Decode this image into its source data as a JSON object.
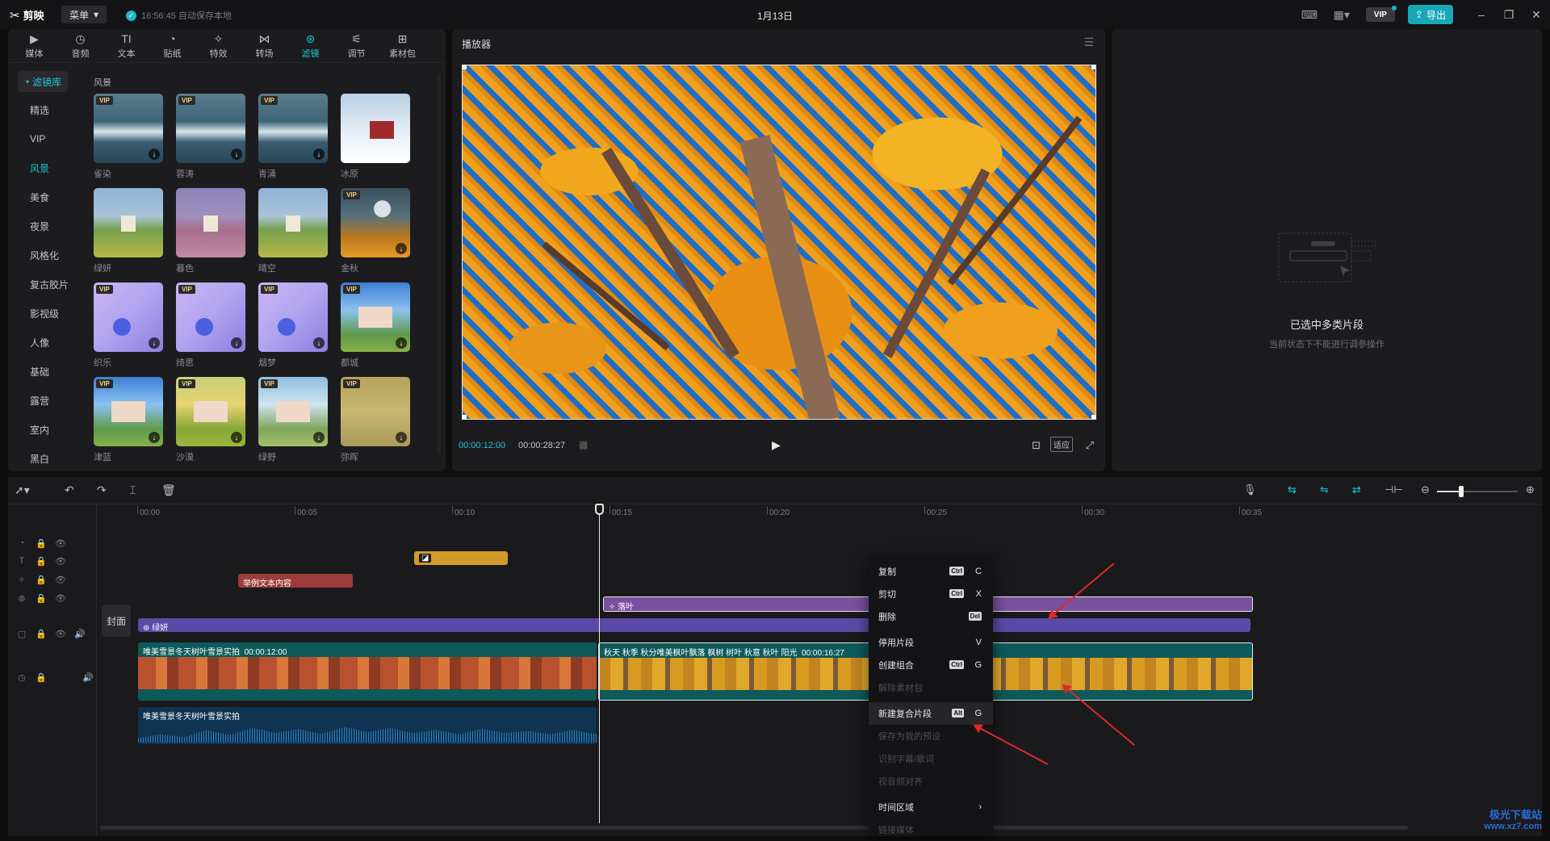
{
  "app": {
    "name": "剪映",
    "menu_label": "菜单",
    "autosave": "16:56:45 自动保存本地",
    "project_title": "1月13日"
  },
  "titlebar": {
    "vip_label": "VIP",
    "export_label": "导出"
  },
  "categories": [
    {
      "label": "媒体",
      "icon": "media-icon"
    },
    {
      "label": "音频",
      "icon": "audio-icon"
    },
    {
      "label": "文本",
      "icon": "text-icon"
    },
    {
      "label": "贴纸",
      "icon": "sticker-icon"
    },
    {
      "label": "特效",
      "icon": "effect-icon"
    },
    {
      "label": "转场",
      "icon": "transition-icon"
    },
    {
      "label": "滤镜",
      "icon": "filter-icon"
    },
    {
      "label": "调节",
      "icon": "adjust-icon"
    },
    {
      "label": "素材包",
      "icon": "package-icon"
    }
  ],
  "active_category": "滤镜",
  "sidebar": {
    "header": "滤镜库",
    "items": [
      "精选",
      "VIP",
      "风景",
      "美食",
      "夜景",
      "风格化",
      "复古胶片",
      "影视级",
      "人像",
      "基础",
      "露营",
      "室内",
      "黑白"
    ],
    "active": "风景"
  },
  "filter_section_title": "风景",
  "filters": [
    {
      "name": "雀染",
      "vip": true,
      "download": true
    },
    {
      "name": "蓉涛",
      "vip": true,
      "download": true
    },
    {
      "name": "青涌",
      "vip": true,
      "download": true
    },
    {
      "name": "冰原",
      "vip": false,
      "download": false
    },
    {
      "name": "绿妍",
      "vip": false,
      "download": false
    },
    {
      "name": "暮色",
      "vip": false,
      "download": false
    },
    {
      "name": "晴空",
      "vip": false,
      "download": false
    },
    {
      "name": "金秋",
      "vip": true,
      "download": true
    },
    {
      "name": "织乐",
      "vip": true,
      "download": true
    },
    {
      "name": "绮思",
      "vip": true,
      "download": true
    },
    {
      "name": "烟梦",
      "vip": true,
      "download": true
    },
    {
      "name": "都城",
      "vip": true,
      "download": true
    },
    {
      "name": "津蓝",
      "vip": true,
      "download": true
    },
    {
      "name": "沙漠",
      "vip": true,
      "download": true
    },
    {
      "name": "绿野",
      "vip": true,
      "download": true
    },
    {
      "name": "弥晖",
      "vip": true,
      "download": true
    }
  ],
  "vip_tag": "VIP",
  "player": {
    "title": "播放器",
    "current_time": "00:00:12:00",
    "total_time": "00:00:28:27",
    "fit_label": "适应"
  },
  "inspector": {
    "title": "已选中多类片段",
    "subtitle": "当前状态下不能进行调参操作"
  },
  "timeline": {
    "ruler": [
      "00:00",
      "00:05",
      "00:10",
      "00:15",
      "00:20",
      "00:25",
      "00:30",
      "00:35"
    ],
    "cover_label": "封面",
    "text_clip": "举例文本内容",
    "effect_clip": "落叶",
    "filter_clip": "绿妍",
    "video_clip_a": {
      "title": "唯美雪景冬天树叶雪景实拍",
      "duration": "00:00:12:00"
    },
    "video_clip_b": {
      "title": "秋天 秋季 秋分唯美枫叶飘落 枫树 树叶 秋意 秋叶 阳光",
      "duration": "00:00:16:27"
    },
    "audio_clip": "唯美雪景冬天树叶雪景实拍"
  },
  "context_menu": [
    {
      "label": "复制",
      "mod": "Ctrl",
      "key": "C",
      "disabled": false
    },
    {
      "label": "剪切",
      "mod": "Ctrl",
      "key": "X",
      "disabled": false
    },
    {
      "label": "删除",
      "mod": "Del",
      "key": "",
      "disabled": false
    },
    {
      "label": "停用片段",
      "mod": "",
      "key": "V",
      "disabled": false
    },
    {
      "label": "创建组合",
      "mod": "Ctrl",
      "key": "G",
      "disabled": false
    },
    {
      "label": "解除素材包",
      "mod": "",
      "key": "",
      "disabled": true
    },
    {
      "label": "新建复合片段",
      "mod": "Alt",
      "key": "G",
      "disabled": false
    },
    {
      "label": "保存为我的预设",
      "mod": "",
      "key": "",
      "disabled": true
    },
    {
      "label": "识别字幕/歌词",
      "mod": "",
      "key": "",
      "disabled": true
    },
    {
      "label": "视音频对齐",
      "mod": "",
      "key": "",
      "disabled": true
    },
    {
      "label": "时间区域",
      "mod": "",
      "key": "›",
      "disabled": false
    },
    {
      "label": "链接媒体",
      "mod": "",
      "key": "",
      "disabled": true
    }
  ],
  "watermark": {
    "name": "极光下载站",
    "url": "www.xz7.com"
  }
}
